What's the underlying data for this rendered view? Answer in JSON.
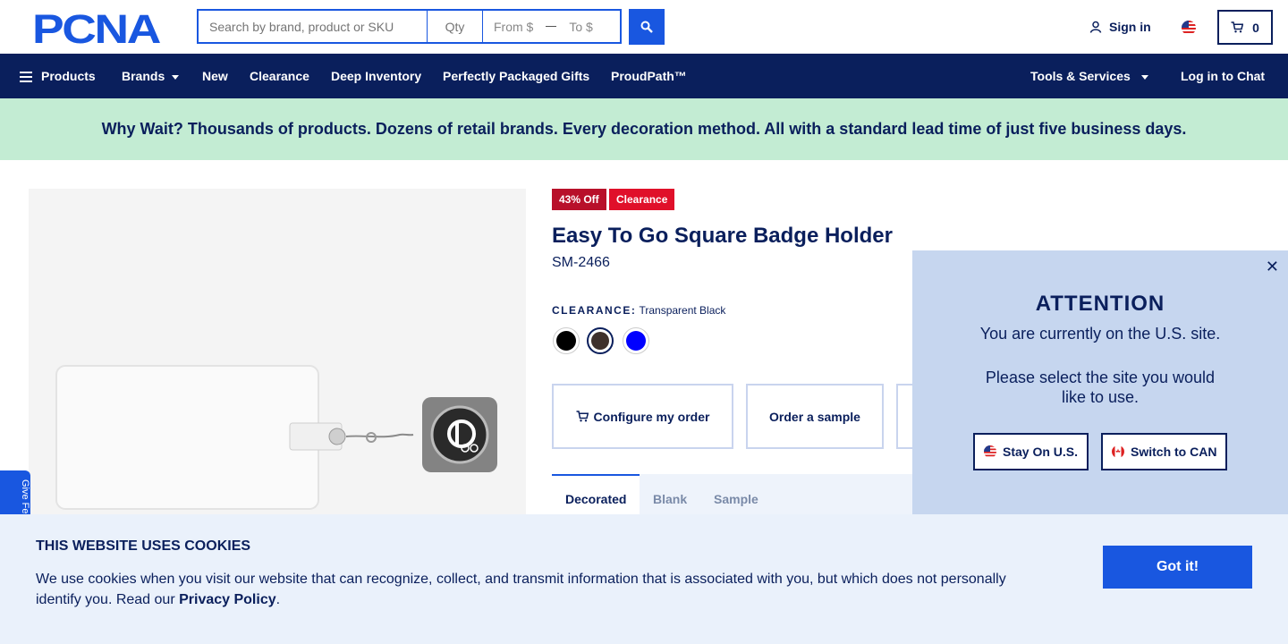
{
  "header": {
    "logo_text": "PCNA",
    "search": {
      "placeholder": "Search by brand, product or SKU",
      "qty_placeholder": "Qty",
      "from_placeholder": "From $",
      "to_placeholder": "To $"
    },
    "signin_label": "Sign in",
    "cart_count": "0"
  },
  "nav": {
    "products": "Products",
    "brands": "Brands",
    "new": "New",
    "clearance": "Clearance",
    "deep_inventory": "Deep Inventory",
    "gifts": "Perfectly Packaged Gifts",
    "proudpath": "ProudPath™",
    "tools": "Tools & Services",
    "chat": "Log in to Chat"
  },
  "banner": {
    "text": "Why Wait? Thousands of products. Dozens of retail brands. Every decoration method. All with a standard lead time of just five business days."
  },
  "product": {
    "badges": [
      "43% Off",
      "Clearance"
    ],
    "title": "Easy To Go Square Badge Holder",
    "sku": "SM-2466",
    "color_key": "CLEARANCE:",
    "color_value": "Transparent Black",
    "swatches": [
      {
        "name": "Black",
        "color": "#000000"
      },
      {
        "name": "Transparent Black",
        "color": "#3e302b"
      },
      {
        "name": "Blue",
        "color": "#0000ff"
      }
    ],
    "actions": {
      "configure": "Configure my order",
      "sample": "Order a sample"
    },
    "tabs": [
      "Decorated",
      "Blank",
      "Sample"
    ]
  },
  "popup": {
    "title": "ATTENTION",
    "line1": "You are currently on the U.S. site.",
    "line2": "Please select the site you would like to use.",
    "stay": "Stay On U.S.",
    "switch": "Switch to CAN"
  },
  "feedback_tab": "Give Fe",
  "cookie": {
    "title": "THIS WEBSITE USES COOKIES",
    "message": "We use cookies when you visit our website that can recognize, collect, and transmit information that is associated with you, but which does not personally identify you. Read our ",
    "link": "Privacy Policy",
    "suffix": ".",
    "button": "Got it!"
  },
  "colors": {
    "navy": "#0a1f5c",
    "brand_blue": "#1957e0",
    "banner_green": "#c3ecd3",
    "sale_red": "#b8102a"
  }
}
